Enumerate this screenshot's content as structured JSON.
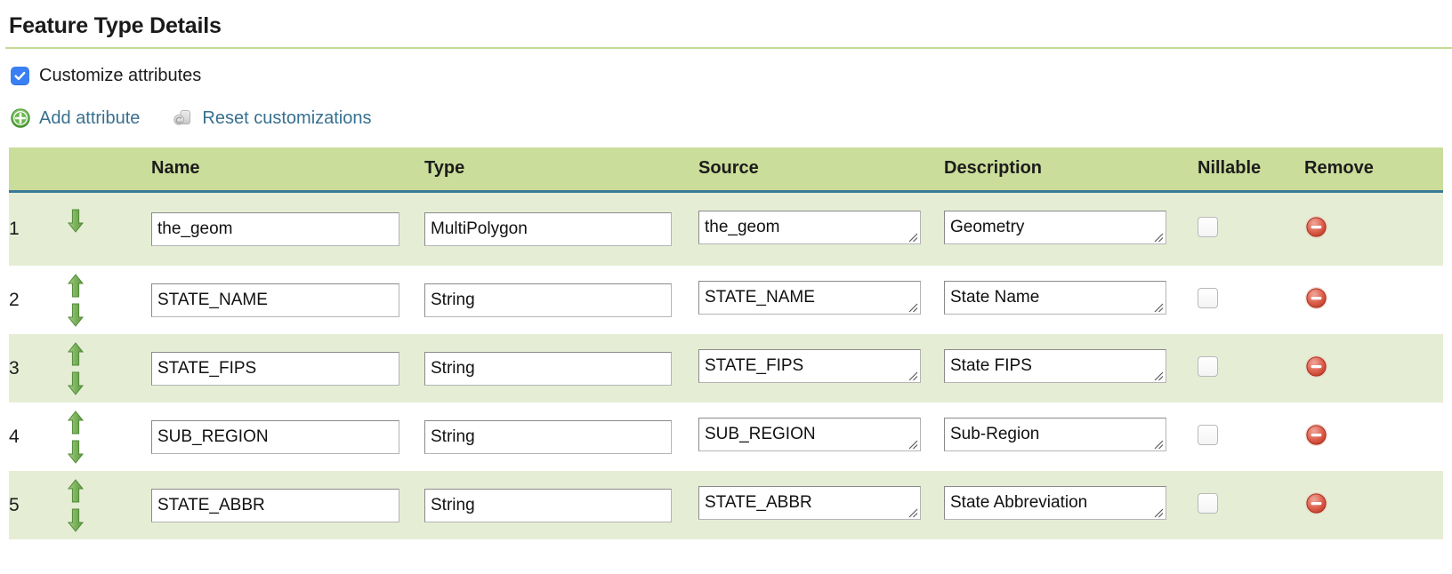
{
  "page": {
    "title": "Feature Type Details"
  },
  "customize": {
    "label": "Customize attributes",
    "checked": true,
    "checkbox_color": "#3b7ff5"
  },
  "actions": {
    "add_attribute": "Add attribute",
    "reset_customizations": "Reset customizations",
    "link_color": "#37708f"
  },
  "table": {
    "header_bg": "#cbdd9a",
    "header_rule_color": "#3a7a96",
    "row_odd_bg": "#e5eed5",
    "row_even_bg": "#ffffff",
    "columns": {
      "index": "",
      "move": "",
      "name": "Name",
      "type": "Type",
      "source": "Source",
      "description": "Description",
      "nillable": "Nillable",
      "remove": "Remove"
    },
    "rows": [
      {
        "index": "1",
        "name": "the_geom",
        "type": "MultiPolygon",
        "source": "the_geom",
        "description": "Geometry",
        "nillable": false,
        "can_move_up": false,
        "can_move_down": true
      },
      {
        "index": "2",
        "name": "STATE_NAME",
        "type": "String",
        "source": "STATE_NAME",
        "description": "State Name",
        "nillable": false,
        "can_move_up": true,
        "can_move_down": true
      },
      {
        "index": "3",
        "name": "STATE_FIPS",
        "type": "String",
        "source": "STATE_FIPS",
        "description": "State FIPS",
        "nillable": false,
        "can_move_up": true,
        "can_move_down": true
      },
      {
        "index": "4",
        "name": "SUB_REGION",
        "type": "String",
        "source": "SUB_REGION",
        "description": "Sub-Region",
        "nillable": false,
        "can_move_up": true,
        "can_move_down": true
      },
      {
        "index": "5",
        "name": "STATE_ABBR",
        "type": "String",
        "source": "STATE_ABBR",
        "description": "State Abbreviation",
        "nillable": false,
        "can_move_up": true,
        "can_move_down": true
      }
    ]
  }
}
